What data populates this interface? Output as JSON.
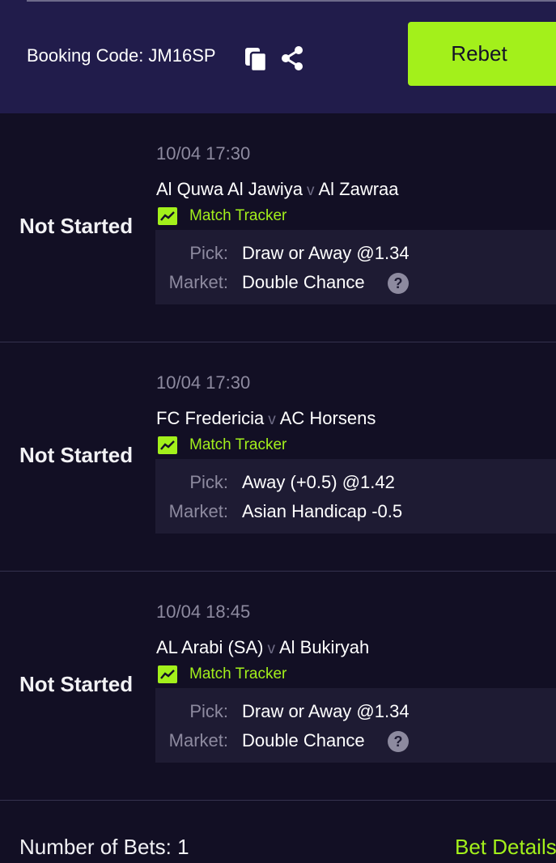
{
  "header": {
    "booking_code": "Booking Code: JM16SP",
    "rebet_label": "Rebet"
  },
  "bets": [
    {
      "status": "Not Started",
      "datetime": "10/04 17:30",
      "home": "Al Quwa Al Jawiya",
      "vs": "v",
      "away": "Al Zawraa",
      "tracker_label": "Match Tracker",
      "pick_label": "Pick:",
      "pick_value": "Draw or Away @1.34",
      "market_label": "Market:",
      "market_value": "Double Chance",
      "help": true
    },
    {
      "status": "Not Started",
      "datetime": "10/04 17:30",
      "home": "FC Fredericia",
      "vs": "v",
      "away": "AC Horsens",
      "tracker_label": "Match Tracker",
      "pick_label": "Pick:",
      "pick_value": "Away (+0.5) @1.42",
      "market_label": "Market:",
      "market_value": "Asian Handicap -0.5",
      "help": false
    },
    {
      "status": "Not Started",
      "datetime": "10/04 18:45",
      "home": "AL Arabi (SA)",
      "vs": "v",
      "away": "Al Bukiryah",
      "tracker_label": "Match Tracker",
      "pick_label": "Pick:",
      "pick_value": "Draw or Away @1.34",
      "market_label": "Market:",
      "market_value": "Double Chance",
      "help": true
    }
  ],
  "footer": {
    "number_of_bets": "Number of Bets: 1",
    "bet_details": "Bet Details"
  },
  "icons": {
    "copy": "copy-icon",
    "share": "share-icon",
    "tracker": "trend-chart-icon",
    "help": "question-mark-icon"
  },
  "colors": {
    "header_bg": "#211c4b",
    "body_bg": "#120f24",
    "accent": "#a3f01b",
    "muted": "#8d8a9f",
    "pick_box_bg": "#1e1b33"
  }
}
